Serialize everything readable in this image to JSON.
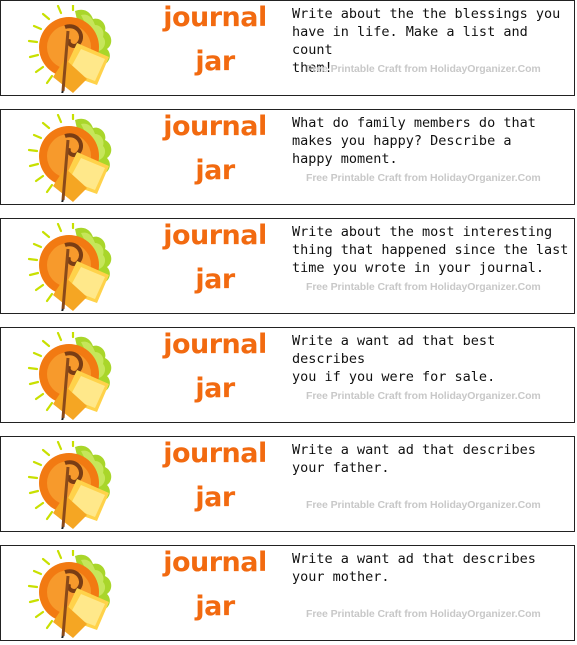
{
  "cards": [
    {
      "title_line1": "journal",
      "title_line2": "jar",
      "prompt": "Write about the the blessings you\nhave in life.  Make a list and count\nthem!",
      "credit": "Free Printable Craft from HolidayOrganizer.Com"
    },
    {
      "title_line1": "journal",
      "title_line2": "jar",
      "prompt": "What do family members do that\nmakes you happy?  Describe a\nhappy moment.",
      "credit": "Free Printable Craft from HolidayOrganizer.Com"
    },
    {
      "title_line1": "journal",
      "title_line2": "jar",
      "prompt": "Write about the most interesting\nthing that happened since the last\ntime you wrote in your journal.",
      "credit": "Free Printable Craft from HolidayOrganizer.Com"
    },
    {
      "title_line1": "journal",
      "title_line2": "jar",
      "prompt": "Write a want ad that best describes\nyou if you were for sale.",
      "credit": "Free Printable Craft from HolidayOrganizer.Com"
    },
    {
      "title_line1": "journal",
      "title_line2": "jar",
      "prompt": "Write a want ad that describes\nyour father.",
      "credit": "Free Printable Craft from HolidayOrganizer.Com"
    },
    {
      "title_line1": "journal",
      "title_line2": "jar",
      "prompt": "Write a want ad that describes\nyour mother.",
      "credit": "Free Printable Craft from HolidayOrganizer.Com"
    }
  ],
  "colors": {
    "title": "#f26a10",
    "credit": "#c8c8c8",
    "border": "#222222"
  },
  "icon": "journal-sun-pen-icon"
}
